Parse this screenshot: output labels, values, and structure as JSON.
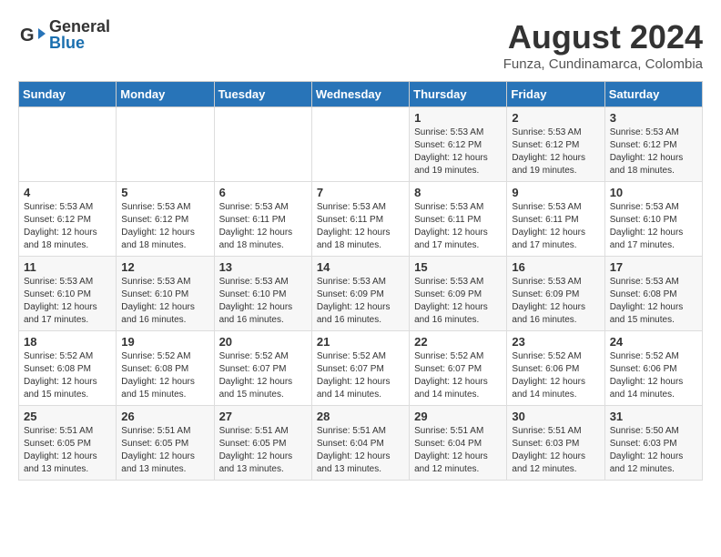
{
  "header": {
    "logo_general": "General",
    "logo_blue": "Blue",
    "month_title": "August 2024",
    "subtitle": "Funza, Cundinamarca, Colombia"
  },
  "days_of_week": [
    "Sunday",
    "Monday",
    "Tuesday",
    "Wednesday",
    "Thursday",
    "Friday",
    "Saturday"
  ],
  "weeks": [
    [
      {
        "day": "",
        "info": ""
      },
      {
        "day": "",
        "info": ""
      },
      {
        "day": "",
        "info": ""
      },
      {
        "day": "",
        "info": ""
      },
      {
        "day": "1",
        "info": "Sunrise: 5:53 AM\nSunset: 6:12 PM\nDaylight: 12 hours\nand 19 minutes."
      },
      {
        "day": "2",
        "info": "Sunrise: 5:53 AM\nSunset: 6:12 PM\nDaylight: 12 hours\nand 19 minutes."
      },
      {
        "day": "3",
        "info": "Sunrise: 5:53 AM\nSunset: 6:12 PM\nDaylight: 12 hours\nand 18 minutes."
      }
    ],
    [
      {
        "day": "4",
        "info": "Sunrise: 5:53 AM\nSunset: 6:12 PM\nDaylight: 12 hours\nand 18 minutes."
      },
      {
        "day": "5",
        "info": "Sunrise: 5:53 AM\nSunset: 6:12 PM\nDaylight: 12 hours\nand 18 minutes."
      },
      {
        "day": "6",
        "info": "Sunrise: 5:53 AM\nSunset: 6:11 PM\nDaylight: 12 hours\nand 18 minutes."
      },
      {
        "day": "7",
        "info": "Sunrise: 5:53 AM\nSunset: 6:11 PM\nDaylight: 12 hours\nand 18 minutes."
      },
      {
        "day": "8",
        "info": "Sunrise: 5:53 AM\nSunset: 6:11 PM\nDaylight: 12 hours\nand 17 minutes."
      },
      {
        "day": "9",
        "info": "Sunrise: 5:53 AM\nSunset: 6:11 PM\nDaylight: 12 hours\nand 17 minutes."
      },
      {
        "day": "10",
        "info": "Sunrise: 5:53 AM\nSunset: 6:10 PM\nDaylight: 12 hours\nand 17 minutes."
      }
    ],
    [
      {
        "day": "11",
        "info": "Sunrise: 5:53 AM\nSunset: 6:10 PM\nDaylight: 12 hours\nand 17 minutes."
      },
      {
        "day": "12",
        "info": "Sunrise: 5:53 AM\nSunset: 6:10 PM\nDaylight: 12 hours\nand 16 minutes."
      },
      {
        "day": "13",
        "info": "Sunrise: 5:53 AM\nSunset: 6:10 PM\nDaylight: 12 hours\nand 16 minutes."
      },
      {
        "day": "14",
        "info": "Sunrise: 5:53 AM\nSunset: 6:09 PM\nDaylight: 12 hours\nand 16 minutes."
      },
      {
        "day": "15",
        "info": "Sunrise: 5:53 AM\nSunset: 6:09 PM\nDaylight: 12 hours\nand 16 minutes."
      },
      {
        "day": "16",
        "info": "Sunrise: 5:53 AM\nSunset: 6:09 PM\nDaylight: 12 hours\nand 16 minutes."
      },
      {
        "day": "17",
        "info": "Sunrise: 5:53 AM\nSunset: 6:08 PM\nDaylight: 12 hours\nand 15 minutes."
      }
    ],
    [
      {
        "day": "18",
        "info": "Sunrise: 5:52 AM\nSunset: 6:08 PM\nDaylight: 12 hours\nand 15 minutes."
      },
      {
        "day": "19",
        "info": "Sunrise: 5:52 AM\nSunset: 6:08 PM\nDaylight: 12 hours\nand 15 minutes."
      },
      {
        "day": "20",
        "info": "Sunrise: 5:52 AM\nSunset: 6:07 PM\nDaylight: 12 hours\nand 15 minutes."
      },
      {
        "day": "21",
        "info": "Sunrise: 5:52 AM\nSunset: 6:07 PM\nDaylight: 12 hours\nand 14 minutes."
      },
      {
        "day": "22",
        "info": "Sunrise: 5:52 AM\nSunset: 6:07 PM\nDaylight: 12 hours\nand 14 minutes."
      },
      {
        "day": "23",
        "info": "Sunrise: 5:52 AM\nSunset: 6:06 PM\nDaylight: 12 hours\nand 14 minutes."
      },
      {
        "day": "24",
        "info": "Sunrise: 5:52 AM\nSunset: 6:06 PM\nDaylight: 12 hours\nand 14 minutes."
      }
    ],
    [
      {
        "day": "25",
        "info": "Sunrise: 5:51 AM\nSunset: 6:05 PM\nDaylight: 12 hours\nand 13 minutes."
      },
      {
        "day": "26",
        "info": "Sunrise: 5:51 AM\nSunset: 6:05 PM\nDaylight: 12 hours\nand 13 minutes."
      },
      {
        "day": "27",
        "info": "Sunrise: 5:51 AM\nSunset: 6:05 PM\nDaylight: 12 hours\nand 13 minutes."
      },
      {
        "day": "28",
        "info": "Sunrise: 5:51 AM\nSunset: 6:04 PM\nDaylight: 12 hours\nand 13 minutes."
      },
      {
        "day": "29",
        "info": "Sunrise: 5:51 AM\nSunset: 6:04 PM\nDaylight: 12 hours\nand 12 minutes."
      },
      {
        "day": "30",
        "info": "Sunrise: 5:51 AM\nSunset: 6:03 PM\nDaylight: 12 hours\nand 12 minutes."
      },
      {
        "day": "31",
        "info": "Sunrise: 5:50 AM\nSunset: 6:03 PM\nDaylight: 12 hours\nand 12 minutes."
      }
    ]
  ]
}
